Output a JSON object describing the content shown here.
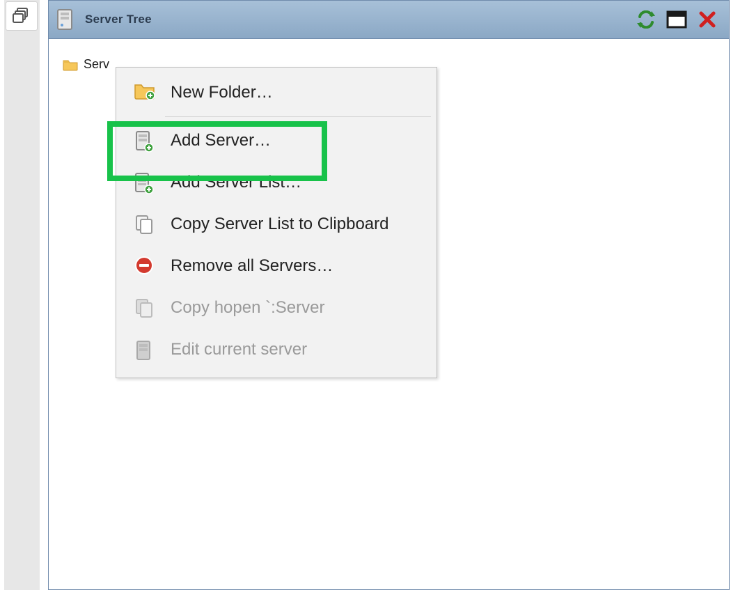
{
  "panel": {
    "title": "Server Tree"
  },
  "tree": {
    "root_label": "Serv"
  },
  "menu": {
    "new_folder": "New Folder…",
    "add_server": "Add Server…",
    "add_server_list": "Add Server List…",
    "copy_list": "Copy Server List to Clipboard",
    "remove_all": "Remove all Servers…",
    "copy_hopen": "Copy hopen `:Server",
    "edit_current": "Edit current server"
  }
}
